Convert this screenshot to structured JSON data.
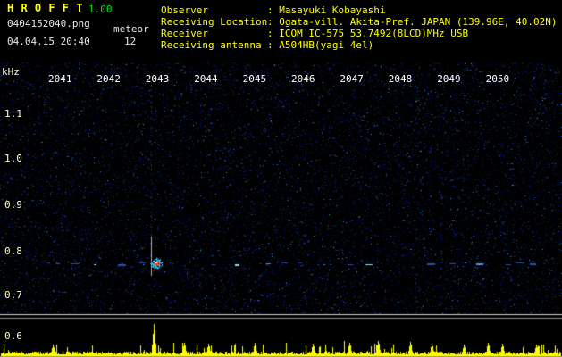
{
  "header": {
    "app_name": "H R O F F T",
    "app_version": "1.00",
    "filename": "0404152040.png",
    "mode": "meteor",
    "datetime": "04.04.15 20:40",
    "echo_count": "12",
    "colon": ": ",
    "info": [
      {
        "label": "Observer",
        "value": "Masayuki Kobayashi"
      },
      {
        "label": "Receiving Location",
        "value": "Ogata-vill. Akita-Pref. JAPAN (139.96E, 40.02N)"
      },
      {
        "label": "Receiver",
        "value": "ICOM IC-575 53.7492(8LCD)MHz USB"
      },
      {
        "label": "Receiving antenna",
        "value": "A504HB(yagi 4el)"
      }
    ]
  },
  "chart_data": {
    "type": "heatmap",
    "description": "HROFFT meteor-scatter radio spectrogram (waterfall) with power plot below",
    "ylabel": "kHz",
    "x_ticks": [
      "2041",
      "2042",
      "2043",
      "2044",
      "2045",
      "2046",
      "2047",
      "2048",
      "2049",
      "2050"
    ],
    "y_ticks": [
      "1.1",
      "1.0",
      "0.9",
      "0.8",
      "0.7",
      "0.6"
    ],
    "y_range_khz": [
      0.6,
      1.15
    ],
    "carrier_band_khz": 0.77,
    "meteor_echo": {
      "time": "20:42.9",
      "freq_khz": 0.77,
      "minutes_after_start": 2.93
    },
    "power_plot": {
      "color": "#ffff00",
      "spikes": [
        {
          "t_min": 0.85,
          "amp": 0.22
        },
        {
          "t_min": 2.93,
          "amp": 1.0
        },
        {
          "t_min": 3.55,
          "amp": 0.3
        },
        {
          "t_min": 4.05,
          "amp": 0.27
        },
        {
          "t_min": 5.0,
          "amp": 0.3
        },
        {
          "t_min": 6.2,
          "amp": 0.25
        },
        {
          "t_min": 6.95,
          "amp": 0.3
        },
        {
          "t_min": 7.55,
          "amp": 0.35
        },
        {
          "t_min": 8.2,
          "amp": 0.32
        },
        {
          "t_min": 8.65,
          "amp": 0.27
        },
        {
          "t_min": 9.3,
          "amp": 0.22
        },
        {
          "t_min": 9.8,
          "amp": 0.3
        },
        {
          "t_min": 10.1,
          "amp": 0.26
        },
        {
          "t_min": 10.8,
          "amp": 0.24
        }
      ]
    },
    "colors": {
      "background": "#000000",
      "noise_dim": "#0a2a88",
      "echo_core": "#e02010",
      "echo_halo": "#20c8e8",
      "axis_text": "#ffffff",
      "power": "#ffff00"
    }
  }
}
